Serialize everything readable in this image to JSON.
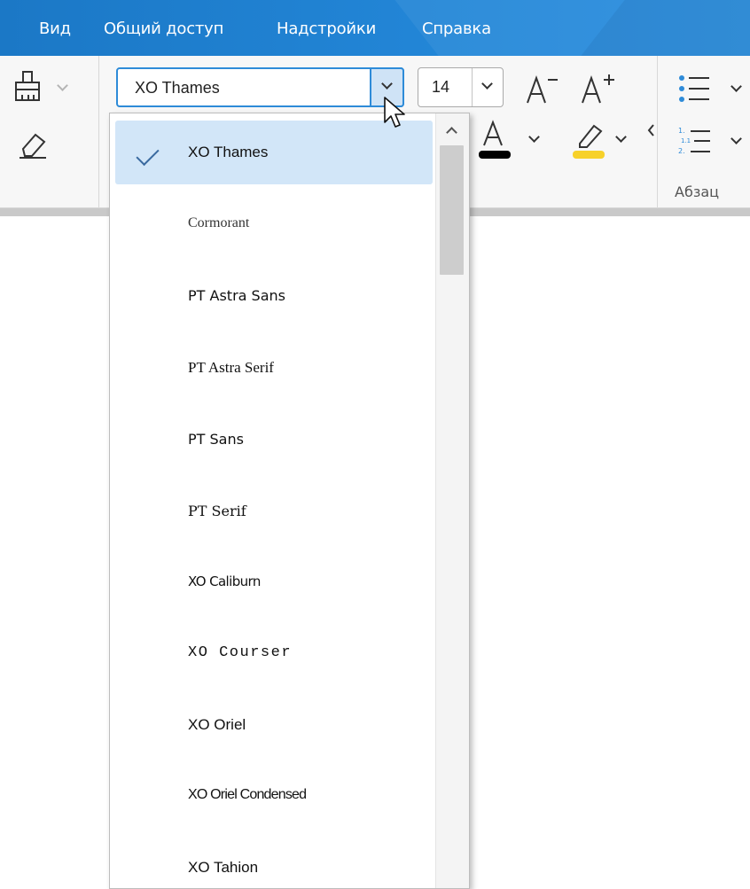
{
  "menu": {
    "items": [
      "Вид",
      "Общий доступ",
      "Надстройки",
      "Справка"
    ]
  },
  "toolbar": {
    "font_name": "XO Thames",
    "font_size": "14",
    "paragraph_group_label": "Абзац",
    "icons": [
      "format-painter-icon",
      "eraser-icon",
      "font-color-icon",
      "highlight-icon",
      "bullet-list-icon",
      "numbered-list-icon",
      "increase-font-icon",
      "decrease-font-icon"
    ],
    "font_color": "#000000",
    "highlight_color": "#f7d12a"
  },
  "font_dropdown": {
    "selected": "XO Thames",
    "items": [
      "XO Thames",
      "Cormorant",
      "PT Astra Sans",
      "PT Astra Serif",
      "PT Sans",
      "PT Serif",
      "XO Caliburn",
      "XO Courser",
      "XO Oriel",
      "XO Oriel Condensed",
      "XO Tahion"
    ]
  },
  "colors": {
    "menu_bar": "#1b78c6",
    "accent": "#2e8bd8",
    "selected_item": "#d2e6f8"
  }
}
